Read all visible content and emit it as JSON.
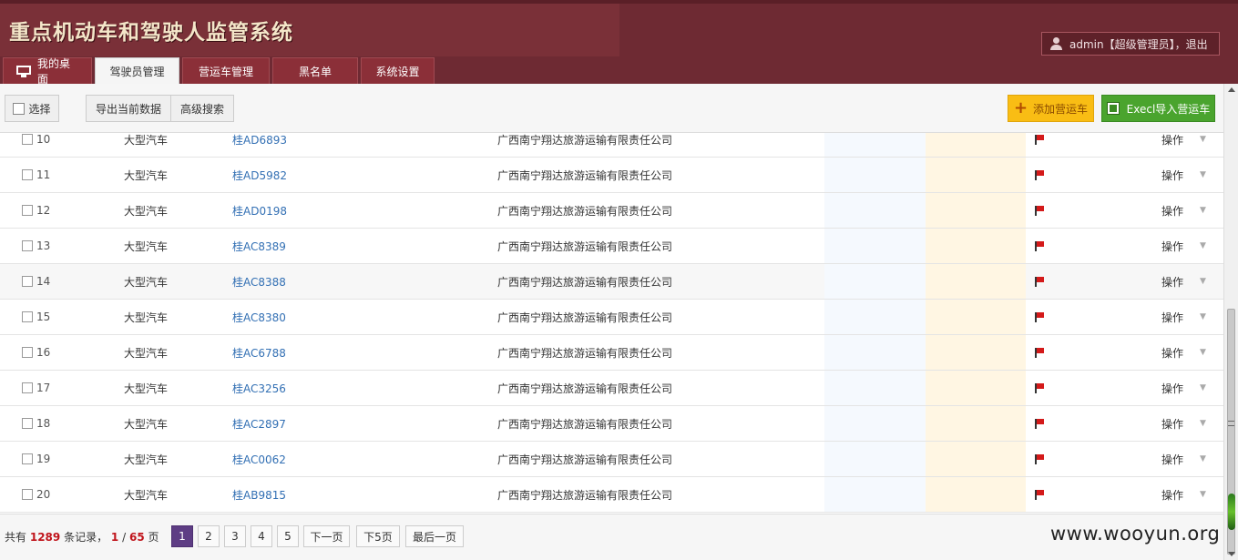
{
  "header": {
    "title": "重点机动车和驾驶人监管系统",
    "user_text": "admin【超级管理员】，退出"
  },
  "nav": {
    "tabs": [
      "我的桌面",
      "驾驶员管理",
      "营运车管理",
      "黑名单",
      "系统设置"
    ],
    "active_tab": "驾驶员管理"
  },
  "toolbar": {
    "select_label": "选择",
    "export_label": "导出当前数据",
    "search_label": "高级搜索",
    "add_label": "添加营运车",
    "import_label": "Execl导入营运车"
  },
  "table": {
    "rows": [
      {
        "no": "10",
        "type": "大型汽车",
        "plate": "桂AD6893",
        "company": "广西南宁翔达旅游运输有限责任公司",
        "op": "操作"
      },
      {
        "no": "11",
        "type": "大型汽车",
        "plate": "桂AD5982",
        "company": "广西南宁翔达旅游运输有限责任公司",
        "op": "操作"
      },
      {
        "no": "12",
        "type": "大型汽车",
        "plate": "桂AD0198",
        "company": "广西南宁翔达旅游运输有限责任公司",
        "op": "操作"
      },
      {
        "no": "13",
        "type": "大型汽车",
        "plate": "桂AC8389",
        "company": "广西南宁翔达旅游运输有限责任公司",
        "op": "操作"
      },
      {
        "no": "14",
        "type": "大型汽车",
        "plate": "桂AC8388",
        "company": "广西南宁翔达旅游运输有限责任公司",
        "op": "操作"
      },
      {
        "no": "15",
        "type": "大型汽车",
        "plate": "桂AC8380",
        "company": "广西南宁翔达旅游运输有限责任公司",
        "op": "操作"
      },
      {
        "no": "16",
        "type": "大型汽车",
        "plate": "桂AC6788",
        "company": "广西南宁翔达旅游运输有限责任公司",
        "op": "操作"
      },
      {
        "no": "17",
        "type": "大型汽车",
        "plate": "桂AC3256",
        "company": "广西南宁翔达旅游运输有限责任公司",
        "op": "操作"
      },
      {
        "no": "18",
        "type": "大型汽车",
        "plate": "桂AC2897",
        "company": "广西南宁翔达旅游运输有限责任公司",
        "op": "操作"
      },
      {
        "no": "19",
        "type": "大型汽车",
        "plate": "桂AC0062",
        "company": "广西南宁翔达旅游运输有限责任公司",
        "op": "操作"
      },
      {
        "no": "20",
        "type": "大型汽车",
        "plate": "桂AB9815",
        "company": "广西南宁翔达旅游运输有限责任公司",
        "op": "操作"
      }
    ]
  },
  "pager": {
    "prefix": "共有",
    "total": "1289",
    "records_label": "条记录，",
    "current": "1",
    "sep": "/",
    "pages": "65",
    "page_suffix": "页",
    "buttons": [
      "1",
      "2",
      "3",
      "4",
      "5",
      "下一页",
      "下5页",
      "最后一页"
    ]
  },
  "watermark": "www.wooyun.org",
  "colors": {
    "header_bg": "#6e2a33",
    "tab_bg": "#8b2f38",
    "add_btn": "#f9bd14",
    "import_btn": "#4aa42e",
    "current_page": "#5e3d84",
    "plate_link": "#3370b4"
  }
}
